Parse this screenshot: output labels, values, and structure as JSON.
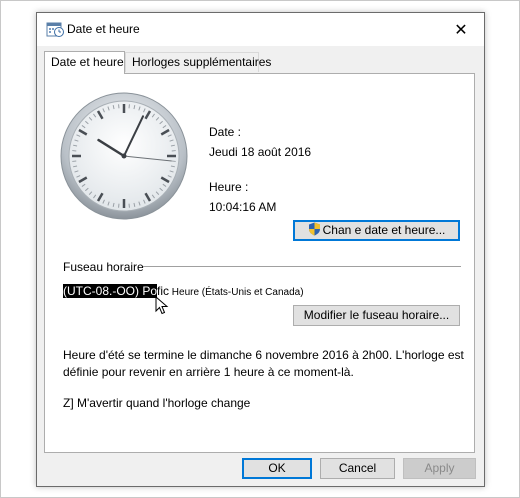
{
  "window": {
    "title": "Date et heure",
    "close_glyph": "✕",
    "icon": "clock-calendar-icon"
  },
  "tabs": [
    {
      "label": "Date et heure",
      "active": true
    },
    {
      "label": "Horloges supplémentaires",
      "active": false
    }
  ],
  "datetime": {
    "date_label": "Date :",
    "date_value": "Jeudi 18 août 2016",
    "time_label": "Heure :",
    "time_value": "10:04:16 AM",
    "change_button": "Chan e date et heure..."
  },
  "clock": {
    "hour": 10,
    "minute": 4,
    "second": 16
  },
  "timezone": {
    "section_title": "Fuseau horaire",
    "selected_text": "(UTC-08.-OO) Po",
    "value_rest_1": "",
    "value_rest_2": "fic",
    "value_rest_3": " Heure (États-Unis et Canada)",
    "change_button": "Modifier le fuseau horaire..."
  },
  "dst_notice": "Heure d'été se termine le dimanche 6 novembre 2016 à 2h00. L'horloge est définie pour revenir en arrière 1 heure à ce moment-là.",
  "notify_checkbox": {
    "label": "Z] M'avertir quand l'horloge change"
  },
  "footer": {
    "ok": "OK",
    "cancel": "Cancel",
    "apply": "Apply"
  },
  "colors": {
    "focus_border": "#0078d7",
    "dialog_bg": "#f0f0f0",
    "panel_bg": "#ffffff"
  }
}
